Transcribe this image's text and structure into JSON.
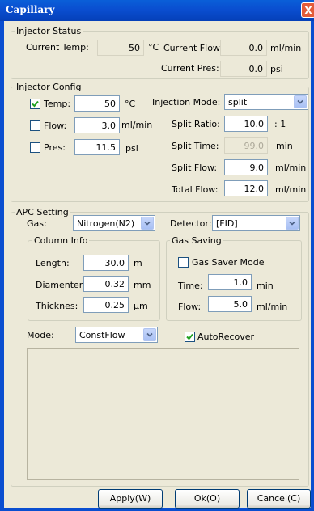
{
  "window": {
    "title": "Capillary",
    "close_glyph": "X"
  },
  "injector_status": {
    "title": "Injector Status",
    "current_temp_label": "Current Temp:",
    "current_temp_value": "50",
    "current_temp_unit": "°C",
    "current_flow_label": "Current Flow:",
    "current_flow_value": "0.0",
    "current_flow_unit": "ml/min",
    "current_pres_label": "Current Pres:",
    "current_pres_value": "0.0",
    "current_pres_unit": "psi"
  },
  "injector_config": {
    "title": "Injector Config",
    "temp": {
      "label": "Temp:",
      "checked": true,
      "value": "50",
      "unit": "°C"
    },
    "flow": {
      "label": "Flow:",
      "checked": false,
      "value": "3.0",
      "unit": "ml/min"
    },
    "pres": {
      "label": "Pres:",
      "checked": false,
      "value": "11.5",
      "unit": "psi"
    },
    "injection_mode_label": "Injection Mode:",
    "injection_mode_value": "split",
    "split_ratio_label": "Split Ratio:",
    "split_ratio_value": "10.0",
    "split_ratio_unit": ": 1",
    "split_time_label": "Split Time:",
    "split_time_value": "99.0",
    "split_time_unit": "min",
    "split_flow_label": "Split Flow:",
    "split_flow_value": "9.0",
    "split_flow_unit": "ml/min",
    "total_flow_label": "Total Flow:",
    "total_flow_value": "12.0",
    "total_flow_unit": "ml/min"
  },
  "apc_setting": {
    "title": "APC Setting",
    "gas_label": "Gas:",
    "gas_value": "Nitrogen(N2)",
    "detector_label": "Detector:",
    "detector_value": "[FID]",
    "column_info": {
      "title": "Column Info",
      "length_label": "Length:",
      "length_value": "30.0",
      "length_unit": "m",
      "diameter_label": "Diamenter",
      "diameter_value": "0.32",
      "diameter_unit": "mm",
      "thickness_label": "Thicknes:",
      "thickness_value": "0.25",
      "thickness_unit": "µm"
    },
    "gas_saving": {
      "title": "Gas Saving",
      "gas_saver_label": "Gas Saver Mode",
      "gas_saver_checked": false,
      "time_label": "Time:",
      "time_value": "1.0",
      "time_unit": "min",
      "flow_label": "Flow:",
      "flow_value": "5.0",
      "flow_unit": "ml/min"
    },
    "mode_label": "Mode:",
    "mode_value": "ConstFlow",
    "autorecover_label": "AutoRecover",
    "autorecover_checked": true
  },
  "buttons": {
    "apply_label": "Apply(W)",
    "ok_label": "Ok(O)",
    "cancel_label": "Cancel(C)"
  },
  "icons": {
    "dropdown": "chevron-down-icon",
    "check": "check-icon",
    "close": "close-icon"
  },
  "colors": {
    "titlebar": "#0a4ed0",
    "close_button": "#e35b3a",
    "dialog_background": "#ece9d8",
    "field_border": "#7f9db9",
    "button_border": "#003c74"
  }
}
